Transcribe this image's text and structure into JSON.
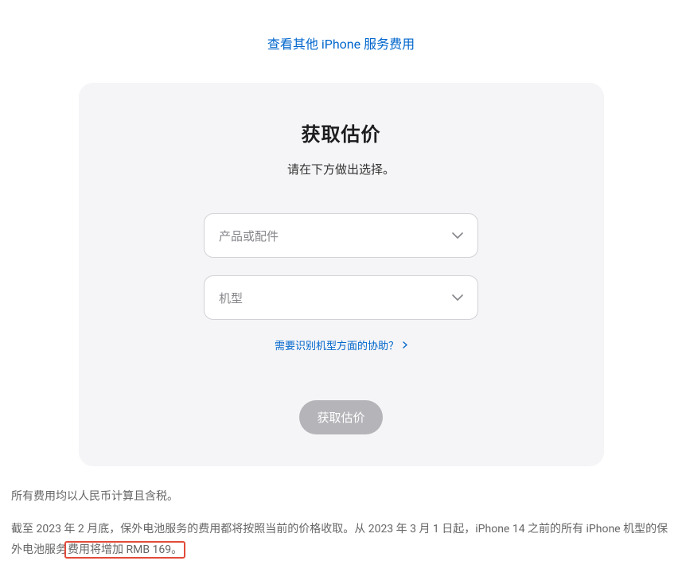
{
  "topLink": "查看其他 iPhone 服务费用",
  "card": {
    "title": "获取估价",
    "subtitle": "请在下方做出选择。",
    "select1": {
      "placeholder": "产品或配件"
    },
    "select2": {
      "placeholder": "机型"
    },
    "helpLink": "需要识别机型方面的协助？",
    "button": "获取估价"
  },
  "footer": {
    "line1": "所有费用均以人民币计算且含税。",
    "line2_prefix": "截至 2023 年 2 月底，保外电池服务的费用都将按照当前的价格收取。从 2023 年 3 月 1 日起，iPhone 14 之前的所有 iPhone 机型的保外电池服务",
    "line2_highlight": "费用将增加 RMB 169。"
  }
}
